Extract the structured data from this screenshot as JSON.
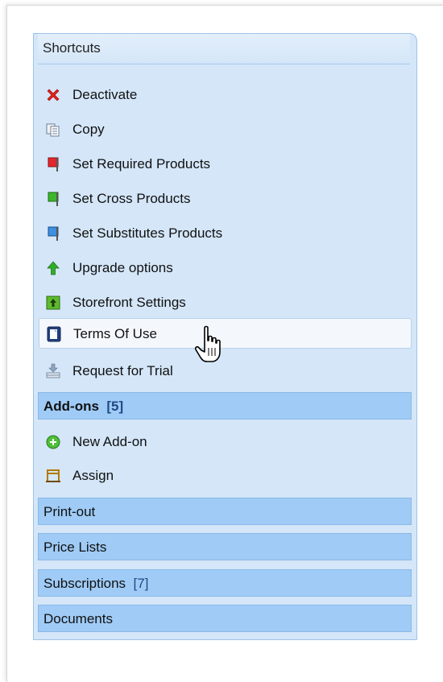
{
  "panel": {
    "title": "Shortcuts",
    "items": [
      {
        "label": "Deactivate",
        "icon": "deactivate-x-icon"
      },
      {
        "label": "Copy",
        "icon": "copy-icon"
      },
      {
        "label": "Set Required Products",
        "icon": "red-flag-icon"
      },
      {
        "label": "Set Cross Products",
        "icon": "green-flag-icon"
      },
      {
        "label": "Set Substitutes Products",
        "icon": "blue-flag-icon"
      },
      {
        "label": "Upgrade options",
        "icon": "green-up-arrow-icon"
      },
      {
        "label": "Storefront Settings",
        "icon": "storefront-settings-icon"
      },
      {
        "label": "Terms Of Use",
        "icon": "document-icon"
      },
      {
        "label": "Request for Trial",
        "icon": "download-tray-icon"
      }
    ]
  },
  "addons": {
    "label": "Add-ons",
    "count": "[5]",
    "items": [
      {
        "label": "New Add-on",
        "icon": "green-plus-circle-icon"
      },
      {
        "label": "Assign",
        "icon": "assign-icon"
      }
    ]
  },
  "sections": {
    "printout": "Print-out",
    "pricelists": "Price Lists",
    "subscriptions": {
      "label": "Subscriptions",
      "count": "[7]"
    },
    "documents": "Documents"
  },
  "colors": {
    "panel_bg": "#d4e6f8",
    "section_bg": "#9fcbf6",
    "count_color": "#1f4b86"
  }
}
